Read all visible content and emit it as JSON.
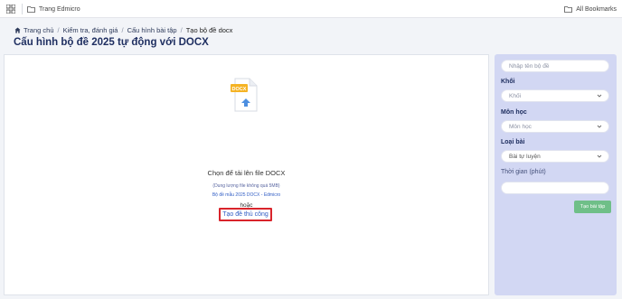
{
  "bookmarks_bar": {
    "items": [
      {
        "label": "Trang Edmicro",
        "icon": "folder-icon"
      }
    ],
    "all_bookmarks": "All Bookmarks"
  },
  "breadcrumb": {
    "items": [
      "Trang chủ",
      "Kiểm tra, đánh giá",
      "Cấu hình bài tập"
    ],
    "current": "Tạo bộ đề docx",
    "separator": "/"
  },
  "page": {
    "title": "Cấu hình bộ đề 2025 tự động với DOCX"
  },
  "upload": {
    "icon_label": "DOCX",
    "prompt": "Chọn để tải lên file DOCX",
    "size_note": "(Dung lượng file không quá 5MB)",
    "sample_link": "Bộ đề mẫu 2025 DOCX - Edmicro",
    "or": "hoặc",
    "manual_button": "Tạo đề thủ công"
  },
  "sidebar": {
    "name_placeholder": "Nhập tên bộ đề",
    "grade_label": "Khối",
    "grade_value": "Khối",
    "subject_label": "Môn học",
    "subject_value": "Môn học",
    "type_label": "Loại bài",
    "type_value": "Bài tự luyện",
    "time_label": "Thời gian (phút)",
    "time_value": "",
    "create_button": "Tạo bài tập"
  },
  "colors": {
    "title": "#1f2f61",
    "link": "#2f5cc4",
    "highlight_border": "#d9242b",
    "sidebar_bg": "#d2d7f3",
    "create_button": "#6fbf88",
    "docx_badge": "#f5b324"
  }
}
